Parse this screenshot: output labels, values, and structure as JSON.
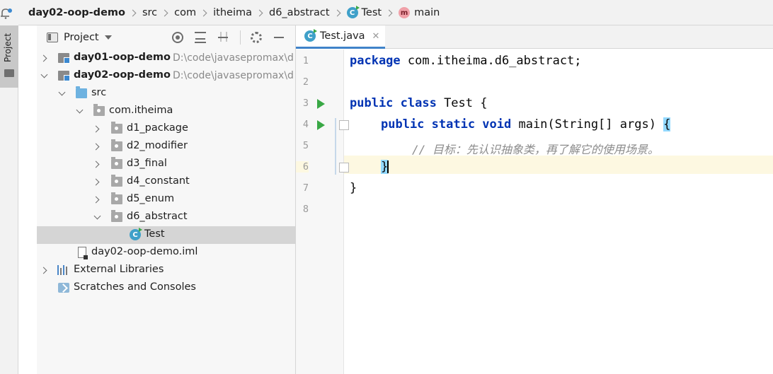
{
  "breadcrumb": {
    "items": [
      "day02-oop-demo",
      "src",
      "com",
      "itheima",
      "d6_abstract",
      "Test",
      "main"
    ]
  },
  "tool_stripe": {
    "label": "Project"
  },
  "project_panel": {
    "title": "Project",
    "tree": [
      {
        "label": "day01-oop-demo",
        "path": "D:\\code\\javasepromax\\d"
      },
      {
        "label": "day02-oop-demo",
        "path": "D:\\code\\javasepromax\\d"
      },
      {
        "label": "src"
      },
      {
        "label": "com.itheima"
      },
      {
        "label": "d1_package"
      },
      {
        "label": "d2_modifier"
      },
      {
        "label": "d3_final"
      },
      {
        "label": "d4_constant"
      },
      {
        "label": "d5_enum"
      },
      {
        "label": "d6_abstract"
      },
      {
        "label": "Test"
      },
      {
        "label": "day02-oop-demo.iml"
      },
      {
        "label": "External Libraries"
      },
      {
        "label": "Scratches and Consoles"
      }
    ]
  },
  "editor": {
    "tab_label": "Test.java",
    "line_numbers": [
      "1",
      "2",
      "3",
      "4",
      "5",
      "6",
      "7",
      "8"
    ],
    "code": {
      "l1_kw": "package",
      "l1_rest": " com.itheima.d6_abstract;",
      "l3_kw": "public class",
      "l3_rest": " Test {",
      "l4_kw": "public static void",
      "l4_rest": " main(String[] args) ",
      "l4_brace": "{",
      "l5_comment": "// 目标：先认识抽象类，再了解它的使用场景。",
      "l6_brace": "}",
      "l7": "}"
    }
  },
  "colors": {
    "keyword": "#0033b3",
    "comment": "#8c8c8c",
    "selection": "#d5d5d5",
    "current_line": "#fdf8e1",
    "brace_match": "#93d9ff",
    "run": "#39a845"
  }
}
